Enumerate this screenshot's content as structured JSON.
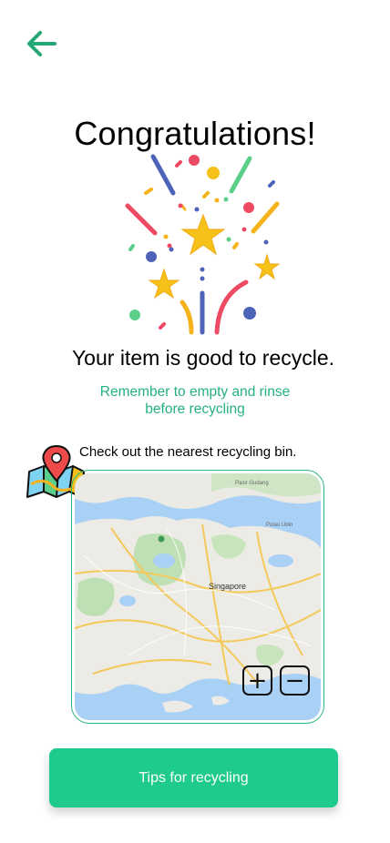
{
  "header": {
    "back_icon": "arrow-left-icon",
    "accent": "#24a874"
  },
  "title": "Congratulations!",
  "headline": "Your item is good to recycle.",
  "hint": {
    "line1": "Remember to empty and rinse",
    "line2": "before recycling",
    "color": "#24b07f"
  },
  "map": {
    "caption": "Check out the nearest recycling bin.",
    "city_label": "Singapore",
    "place_labels": [
      "Pulau Ubin",
      "Pasir Gudang"
    ],
    "zoom_in_label": "+",
    "zoom_out_label": "−",
    "icon": "map-pin-icon"
  },
  "tips_button": {
    "label": "Tips for recycling",
    "color": "#1fcb8c"
  }
}
